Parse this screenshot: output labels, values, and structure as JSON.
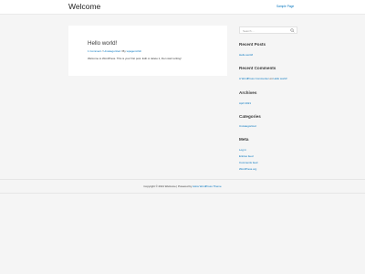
{
  "header": {
    "site_title": "Welcome",
    "nav_link": "Sample Page"
  },
  "post": {
    "title": "Hello world!",
    "comments_link": "1 Comment",
    "separator_1": " / ",
    "category_link": "Uncategorized",
    "separator_2": " / By ",
    "author_link": "wpagent-fish",
    "content": "Welcome to WordPress. This is your first post. Edit or delete it, then start writing!"
  },
  "sidebar": {
    "search_placeholder": "Search ...",
    "recent_posts": {
      "title": "Recent Posts",
      "items": [
        "Hello world!"
      ]
    },
    "recent_comments": {
      "title": "Recent Comments",
      "author": "A WordPress Commenter",
      "on_text": " on ",
      "post": "Hello world!"
    },
    "archives": {
      "title": "Archives",
      "items": [
        "April 2021"
      ]
    },
    "categories": {
      "title": "Categories",
      "items": [
        "Uncategorized"
      ]
    },
    "meta": {
      "title": "Meta",
      "items": [
        "Log in",
        "Entries feed",
        "Comments feed",
        "WordPress.org"
      ]
    }
  },
  "footer": {
    "prefix": "Copyright © 2021 Welcome | Powered by ",
    "link": "Astra WordPress Theme"
  },
  "colors": {
    "link": "#0274be",
    "background": "#f5f5f5",
    "card": "#ffffff"
  }
}
